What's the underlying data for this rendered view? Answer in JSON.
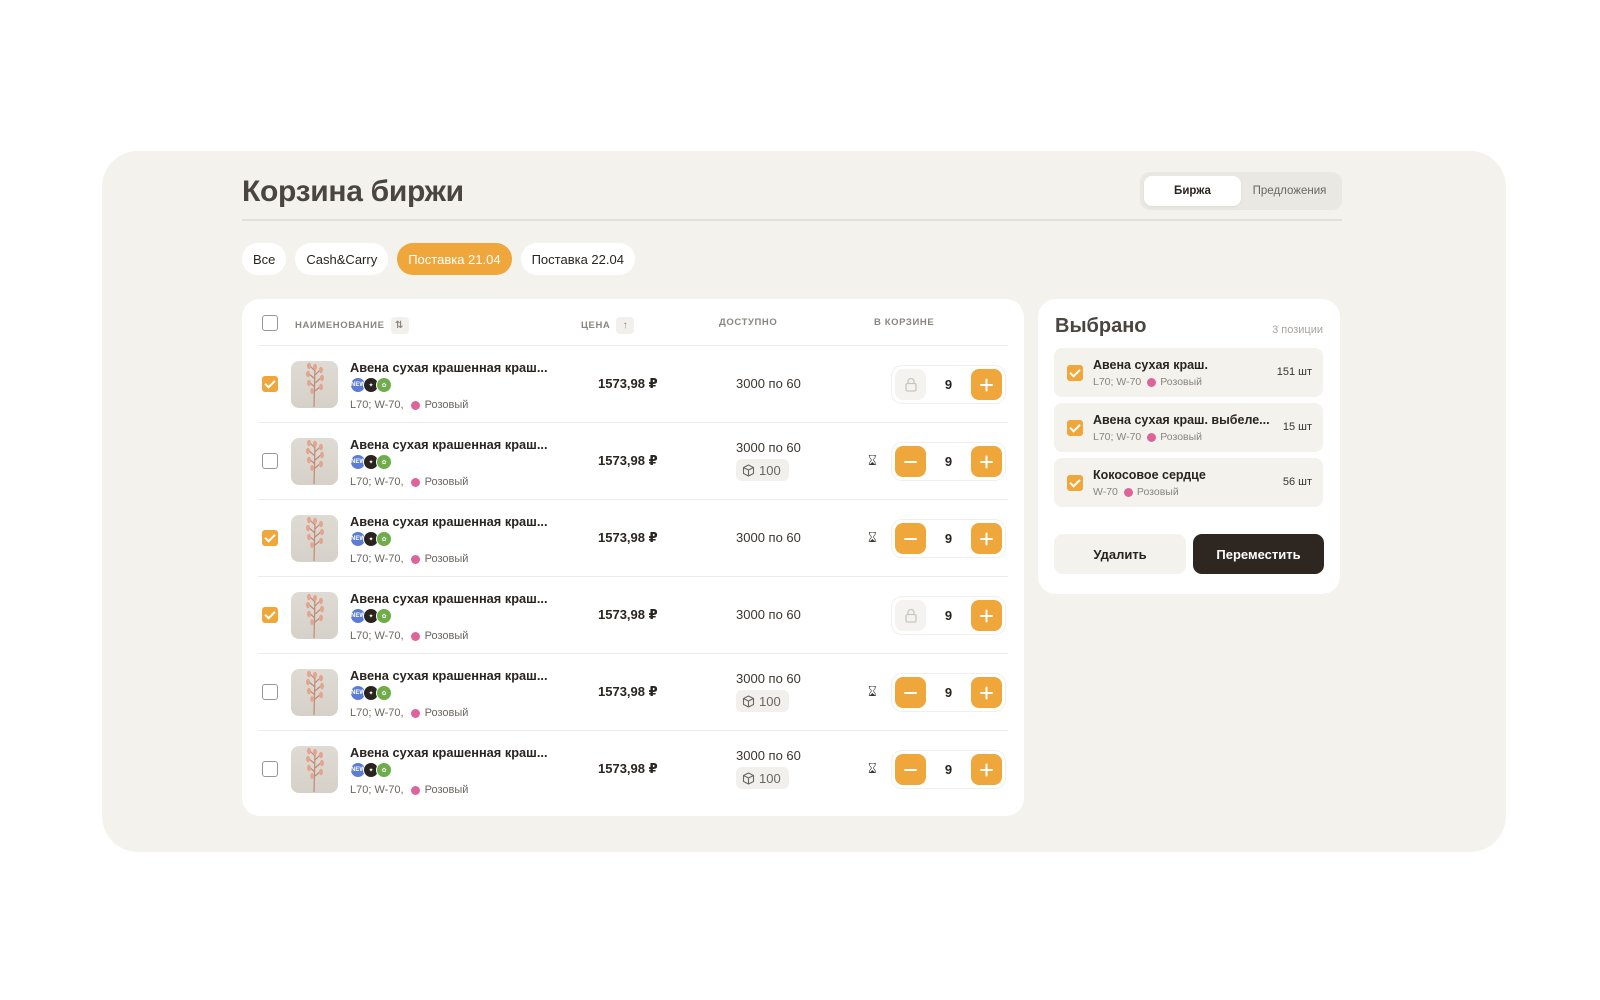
{
  "page": {
    "title": "Корзина биржи"
  },
  "switch": {
    "items": [
      "Биржа",
      "Предложения"
    ],
    "active": "Биржа"
  },
  "filters": {
    "items": [
      "Все",
      "Cash&Carry",
      "Поставка 21.04",
      "Поставка 22.04"
    ],
    "active": "Поставка 21.04"
  },
  "table": {
    "columns": {
      "name": "НАИМЕНОВАНИЕ",
      "price": "ЦЕНА",
      "available": "ДОСТУПНО",
      "in_cart": "В КОРЗИНЕ"
    },
    "rows": [
      {
        "checked": true,
        "name": "Авена сухая крашенная краш...",
        "size": "L70; W-70,",
        "color": "Розовый",
        "price": "1573,98 ₽",
        "available": "3000 по 60",
        "pack": "",
        "quantity": "9",
        "locked": true
      },
      {
        "checked": false,
        "name": "Авена сухая крашенная краш...",
        "size": "L70; W-70,",
        "color": "Розовый",
        "price": "1573,98 ₽",
        "available": "3000 по 60",
        "pack": "100",
        "quantity": "9",
        "locked": false
      },
      {
        "checked": true,
        "name": "Авена сухая крашенная краш...",
        "size": "L70; W-70,",
        "color": "Розовый",
        "price": "1573,98 ₽",
        "available": "3000 по 60",
        "pack": "",
        "quantity": "9",
        "locked": false
      },
      {
        "checked": true,
        "name": "Авена сухая крашенная краш...",
        "size": "L70; W-70,",
        "color": "Розовый",
        "price": "1573,98 ₽",
        "available": "3000 по 60",
        "pack": "",
        "quantity": "9",
        "locked": true
      },
      {
        "checked": false,
        "name": "Авена сухая крашенная краш...",
        "size": "L70; W-70,",
        "color": "Розовый",
        "price": "1573,98 ₽",
        "available": "3000 по 60",
        "pack": "100",
        "quantity": "9",
        "locked": false
      },
      {
        "checked": false,
        "name": "Авена сухая крашенная краш...",
        "size": "L70; W-70,",
        "color": "Розовый",
        "price": "1573,98 ₽",
        "available": "3000 по 60",
        "pack": "100",
        "quantity": "9",
        "locked": false
      }
    ]
  },
  "selected": {
    "title": "Выбрано",
    "count": "3 позиции",
    "items": [
      {
        "name": "Авена сухая краш.",
        "size": "L70; W-70",
        "color": "Розовый",
        "qty": "151 шт"
      },
      {
        "name": "Авена сухая краш. выбеле...",
        "size": "L70; W-70",
        "color": "Розовый",
        "qty": "15 шт"
      },
      {
        "name": "Кокосовое сердце",
        "size": "W-70",
        "color": "Розовый",
        "qty": "56 шт"
      }
    ],
    "delete_label": "Удалить",
    "move_label": "Переместить"
  },
  "colors": {
    "accent": "#efa63a",
    "background": "#f3f2ed",
    "dark_button": "#2e2620",
    "color_dot": "#e0629a"
  },
  "icons": {
    "badges": [
      "new-badge-icon",
      "dark-badge-icon",
      "eco-badge-icon"
    ],
    "sort": "sort-arrows-icon",
    "waiting": "hourglass-icon",
    "package": "box-icon",
    "lock": "lock-icon"
  }
}
